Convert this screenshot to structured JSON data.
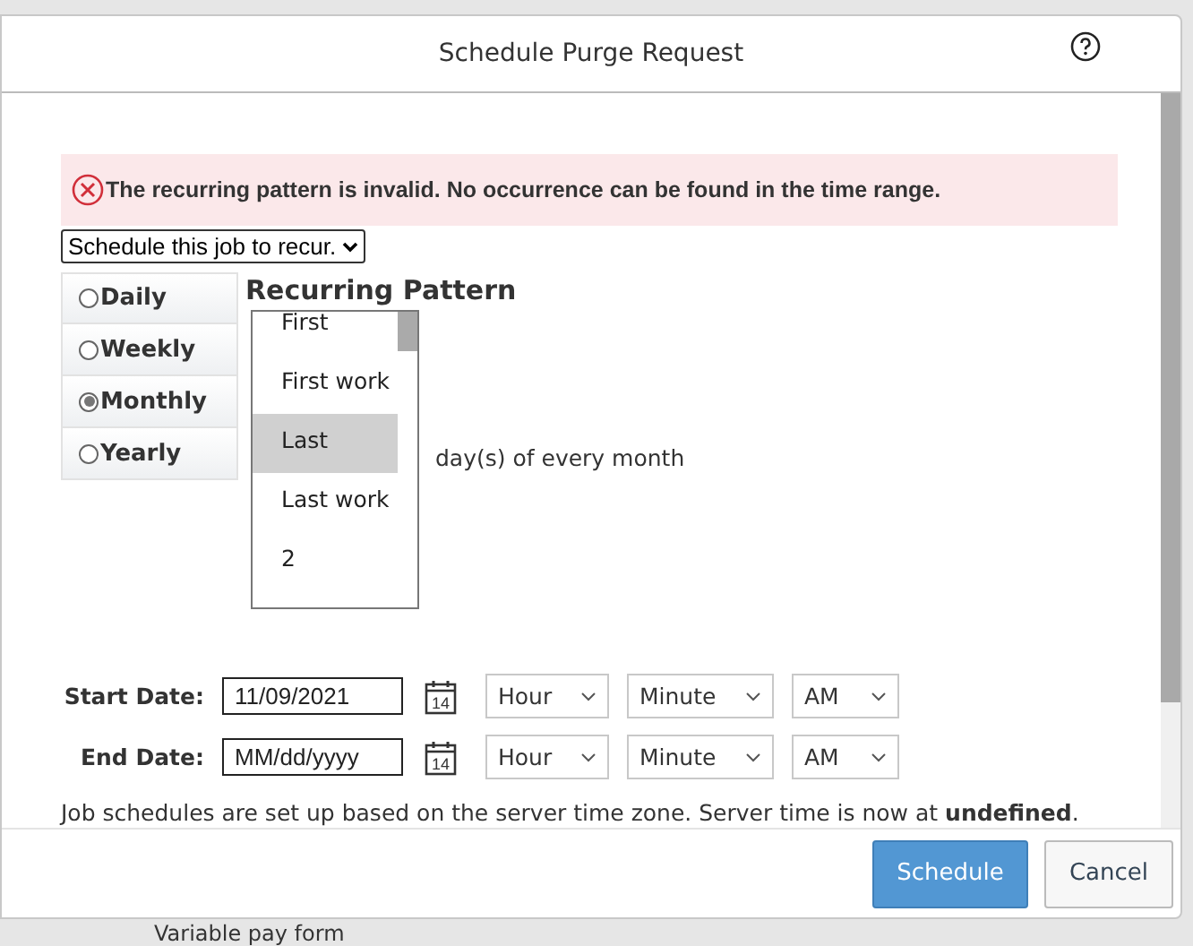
{
  "background": {
    "text": "Variable pay form"
  },
  "dialog": {
    "title": "Schedule Purge Request",
    "error": "The recurring pattern is invalid. No occurrence can be found in the time range.",
    "recurrence_select": {
      "value": "Schedule this job to recur."
    },
    "frequencies": [
      {
        "label": "Daily",
        "selected": false
      },
      {
        "label": "Weekly",
        "selected": false
      },
      {
        "label": "Monthly",
        "selected": true
      },
      {
        "label": "Yearly",
        "selected": false
      }
    ],
    "pattern_heading": "Recurring Pattern",
    "day_list": [
      {
        "label": "First",
        "selected": false
      },
      {
        "label": "First work",
        "selected": false
      },
      {
        "label": "Last",
        "selected": true
      },
      {
        "label": "Last work",
        "selected": false
      },
      {
        "label": "2",
        "selected": false
      }
    ],
    "day_suffix": "day(s) of every month",
    "date_rows": [
      {
        "label": "Start Date:",
        "value": "11/09/2021",
        "calendar_day": "14",
        "hour": "Hour",
        "minute": "Minute",
        "meridiem": "AM"
      },
      {
        "label": "End Date:",
        "placeholder": "MM/dd/yyyy",
        "calendar_day": "14",
        "hour": "Hour",
        "minute": "Minute",
        "meridiem": "AM"
      }
    ],
    "note": "Job schedules are set up based on the server time zone. Server time is now at **undefined**.",
    "buttons": [
      {
        "label": "Schedule",
        "kind": "primary"
      },
      {
        "label": "Cancel",
        "kind": "secondary"
      }
    ]
  }
}
